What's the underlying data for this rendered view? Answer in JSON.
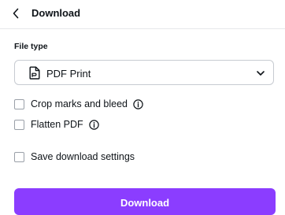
{
  "header": {
    "back_icon": "chevron-left-icon",
    "title": "Download"
  },
  "file_type": {
    "label": "File type",
    "selected": "PDF Print",
    "icon": "document-icon",
    "dropdown_icon": "chevron-down-icon"
  },
  "options": [
    {
      "label": "Crop marks and bleed",
      "checked": false,
      "info_icon": "info-icon"
    },
    {
      "label": "Flatten PDF",
      "checked": false,
      "info_icon": "info-icon"
    },
    {
      "label": "Save download settings",
      "checked": false
    }
  ],
  "download_button": {
    "label": "Download"
  },
  "colors": {
    "accent": "#8b3dff",
    "text": "#0e1318",
    "border": "#c7cbd1"
  }
}
